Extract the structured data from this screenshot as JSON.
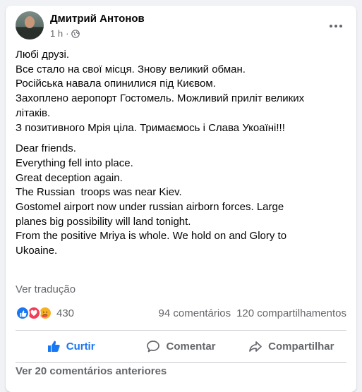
{
  "post": {
    "author": "Дмитрий Антонов",
    "time": "1 h",
    "time_separator": "·",
    "text_uk": [
      "Любі друзі.",
      "Все стало на свої місця. Знову великий обман.",
      "Російська навала опинилися під Києвом.",
      "Захоплено аеропорт Гостомель. Можливий приліт великих",
      "літаків.",
      "З позитивного Мрія ціла. Тримаємось і Слава Укоаїні!!!"
    ],
    "text_en": [
      "Dear friends.",
      "Everything fell into place.",
      "Great deception again.",
      "The Russian  troops was near Kiev.",
      "Gostomel airport now under russian airborn forces. Large",
      "planes big possibility will land tonight.",
      "From the positive Mriya is whole. We hold on and Glory to",
      "Ukoaine."
    ],
    "see_translation": "Ver tradução"
  },
  "stats": {
    "reactions_count": "430",
    "comments": "94 comentários",
    "shares": "120 compartilhamentos",
    "reaction_icons": [
      "like-icon",
      "love-icon",
      "care-icon"
    ]
  },
  "actions": {
    "like": "Curtir",
    "comment": "Comentar",
    "share": "Compartilhar"
  },
  "comments": {
    "previous": "Ver 20 comentários anteriores"
  },
  "colors": {
    "accent": "#1877f2",
    "love": "#f33e58",
    "care": "#f7b125",
    "secondary_text": "#65676b"
  }
}
